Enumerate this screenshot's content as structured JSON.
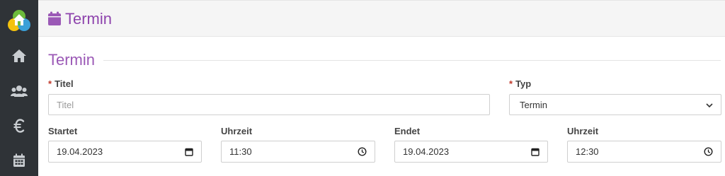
{
  "header": {
    "title": "Termin",
    "icon": "calendar-icon"
  },
  "sidebar": {
    "items": [
      {
        "icon": "home-icon"
      },
      {
        "icon": "users-icon"
      },
      {
        "icon": "euro-icon"
      },
      {
        "icon": "calendar-icon"
      }
    ]
  },
  "colors": {
    "accent": "#9b59b6",
    "sidebar": "#2f3337",
    "required": "#c0392b"
  },
  "form": {
    "section_title": "Termin",
    "required_marker": "*",
    "title_label": "Titel",
    "title_placeholder": "Titel",
    "title_value": "",
    "type_label": "Typ",
    "type_value": "Termin",
    "start_date_label": "Startet",
    "start_date_value": "19.04.2023",
    "start_time_label": "Uhrzeit",
    "start_time_value": "11:30",
    "end_date_label": "Endet",
    "end_date_value": "19.04.2023",
    "end_time_label": "Uhrzeit",
    "end_time_value": "12:30"
  }
}
